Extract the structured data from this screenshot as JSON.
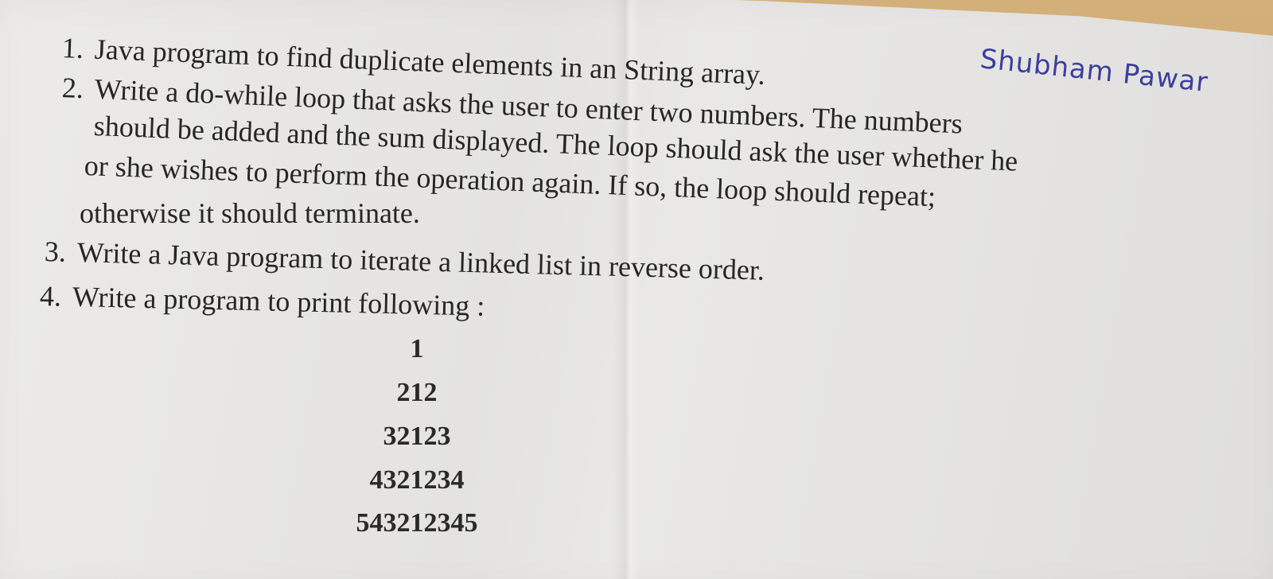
{
  "signature": "Shubham Pawar",
  "questions": [
    {
      "number": "1.",
      "lines": [
        "Java program to find duplicate elements in an String array."
      ]
    },
    {
      "number": "2.",
      "lines": [
        "Write a do-while loop that asks the user to enter two numbers. The numbers",
        "should be added and the sum displayed. The loop should ask the user whether he",
        "or she wishes to perform the operation again. If so, the loop should repeat;",
        "otherwise it should terminate."
      ]
    },
    {
      "number": "3.",
      "lines": [
        "Write a Java program to iterate a linked list in reverse order."
      ]
    },
    {
      "number": "4.",
      "lines": [
        "Write a program to print following :"
      ]
    }
  ],
  "pattern": [
    "1",
    "212",
    "32123",
    "4321234",
    "543212345"
  ]
}
